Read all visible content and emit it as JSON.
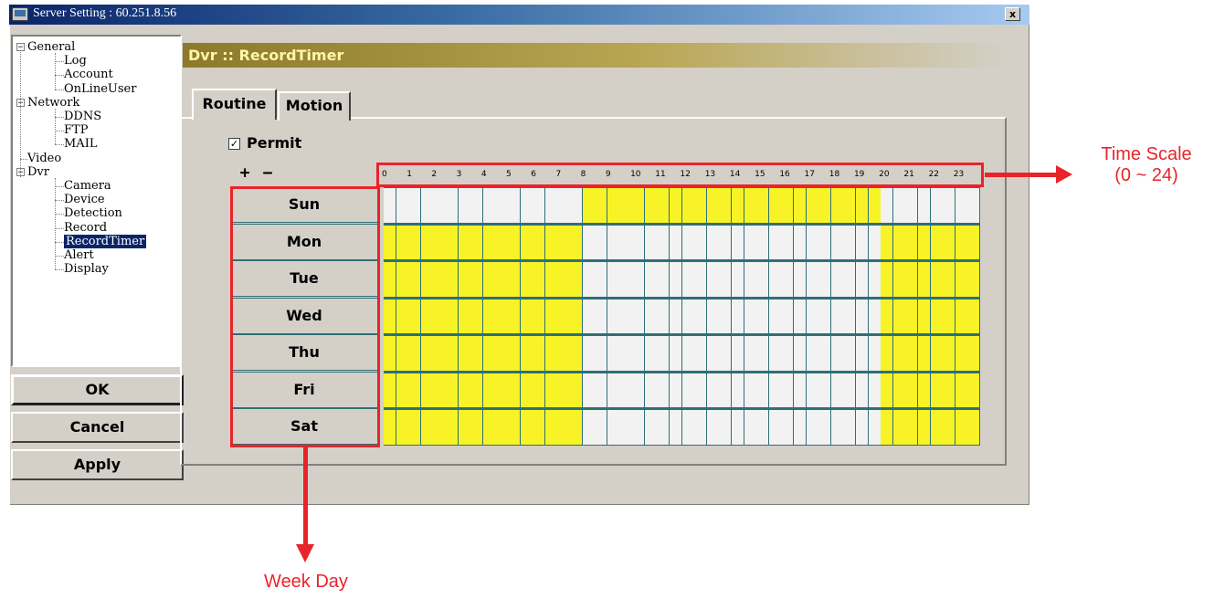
{
  "window": {
    "title": "Server Setting : 60.251.8.56",
    "close_label": "x"
  },
  "tree": {
    "items": [
      {
        "label": "General",
        "level": 0,
        "expander": "−"
      },
      {
        "label": "Log",
        "level": 1
      },
      {
        "label": "Account",
        "level": 1
      },
      {
        "label": "OnLineUser",
        "level": 1
      },
      {
        "label": "Network",
        "level": 0,
        "expander": "−"
      },
      {
        "label": "DDNS",
        "level": 1
      },
      {
        "label": "FTP",
        "level": 1
      },
      {
        "label": "MAIL",
        "level": 1
      },
      {
        "label": "Video",
        "level": 0
      },
      {
        "label": "Dvr",
        "level": 0,
        "expander": "−"
      },
      {
        "label": "Camera",
        "level": 1
      },
      {
        "label": "Device",
        "level": 1
      },
      {
        "label": "Detection",
        "level": 1
      },
      {
        "label": "Record",
        "level": 1
      },
      {
        "label": "RecordTimer",
        "level": 1,
        "selected": true
      },
      {
        "label": "Alert",
        "level": 1
      },
      {
        "label": "Display",
        "level": 1
      }
    ]
  },
  "buttons": {
    "ok": "OK",
    "cancel": "Cancel",
    "apply": "Apply"
  },
  "header": {
    "title": "Dvr :: RecordTimer"
  },
  "tabs": [
    {
      "label": "Routine",
      "active": true
    },
    {
      "label": "Motion",
      "active": false
    }
  ],
  "permit": {
    "label": "Permit",
    "checked": true,
    "check_glyph": "✓"
  },
  "zoom": {
    "plus": "+",
    "minus": "−"
  },
  "hours": [
    "0",
    "1",
    "2",
    "3",
    "4",
    "5",
    "6",
    "7",
    "8",
    "9",
    "10",
    "11",
    "12",
    "13",
    "14",
    "15",
    "16",
    "17",
    "18",
    "19",
    "20",
    "21",
    "22",
    "23"
  ],
  "days": [
    "Sun",
    "Mon",
    "Tue",
    "Wed",
    "Thu",
    "Fri",
    "Sat"
  ],
  "schedule": {
    "slots_per_hour": 2,
    "Sun": {
      "on_from_hour": 8,
      "on_to_hour": 20,
      "mode": "inside"
    },
    "Mon": {
      "on_from_hour": 8,
      "on_to_hour": 20,
      "mode": "outside"
    },
    "Tue": {
      "on_from_hour": 8,
      "on_to_hour": 20,
      "mode": "outside"
    },
    "Wed": {
      "on_from_hour": 8,
      "on_to_hour": 20,
      "mode": "outside"
    },
    "Thu": {
      "on_from_hour": 8,
      "on_to_hour": 20,
      "mode": "outside"
    },
    "Fri": {
      "on_from_hour": 8,
      "on_to_hour": 20,
      "mode": "outside"
    },
    "Sat": {
      "on_from_hour": 8,
      "on_to_hour": 20,
      "mode": "outside"
    }
  },
  "colors": {
    "on": "#f7f326",
    "off": "#f2f2f2",
    "grid_line": "#2f6f77",
    "annotation": "#e8242a"
  },
  "annotations": {
    "time_scale_line1": "Time Scale",
    "time_scale_line2": "(0 ~ 24)",
    "week_day": "Week Day"
  }
}
